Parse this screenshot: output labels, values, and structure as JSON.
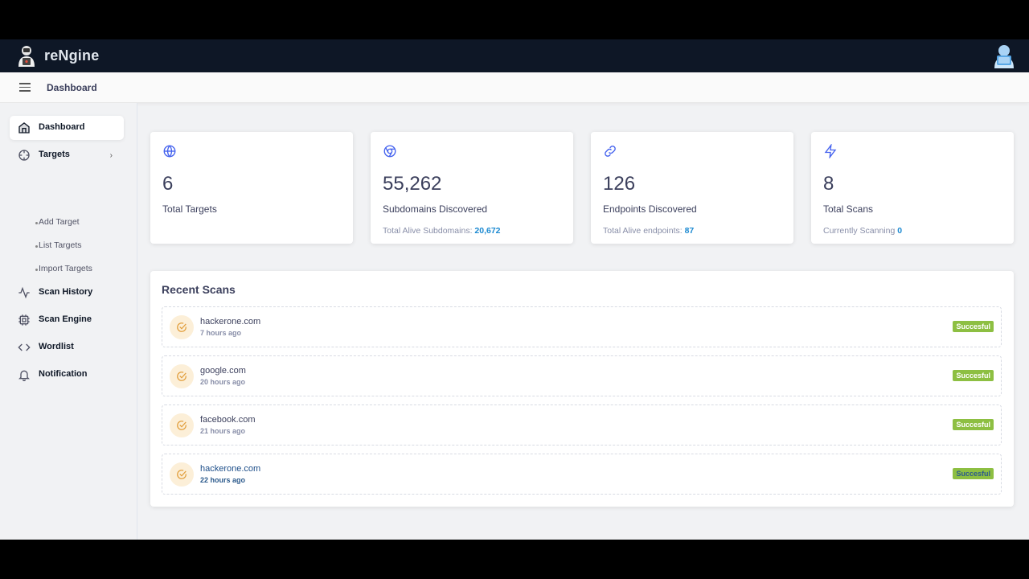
{
  "app": {
    "brand": "reNgine"
  },
  "header": {
    "breadcrumb": "Dashboard"
  },
  "sidebar": {
    "items": [
      {
        "label": "Dashboard",
        "icon": "home-icon",
        "active": true
      },
      {
        "label": "Targets",
        "icon": "target-icon"
      },
      {
        "label": "Scan History",
        "icon": "activity-icon"
      },
      {
        "label": "Scan Engine",
        "icon": "cpu-icon"
      },
      {
        "label": "Wordlist",
        "icon": "code-icon"
      },
      {
        "label": "Notification",
        "icon": "bell-icon"
      }
    ],
    "target_subitems": [
      "Add Target",
      "List Targets",
      "Import Targets"
    ]
  },
  "stats": [
    {
      "value": "6",
      "caption": "Total Targets",
      "icon": "globe-icon"
    },
    {
      "value": "55,262",
      "caption": "Subdomains Discovered",
      "extra_label": "Total Alive Subdomains:",
      "extra_value": "20,672",
      "icon": "chrome-icon"
    },
    {
      "value": "126",
      "caption": "Endpoints Discovered",
      "extra_label": "Total Alive endpoints:",
      "extra_value": "87",
      "icon": "link-icon"
    },
    {
      "value": "8",
      "caption": "Total Scans",
      "extra_label": "Currently Scanning",
      "extra_value": "0",
      "icon": "zap-icon"
    }
  ],
  "recent": {
    "title": "Recent Scans",
    "scans": [
      {
        "domain": "hackerone.com",
        "time": "7 hours ago",
        "status": "Succesful"
      },
      {
        "domain": "google.com",
        "time": "20 hours ago",
        "status": "Succesful"
      },
      {
        "domain": "facebook.com",
        "time": "21 hours ago",
        "status": "Succesful"
      },
      {
        "domain": "hackerone.com",
        "time": "22 hours ago",
        "status": "Succesful"
      }
    ]
  },
  "colors": {
    "topbar": "#0e1726",
    "accent": "#1b89d1",
    "success": "#8dbf42",
    "icon_blue": "#4361ee"
  }
}
